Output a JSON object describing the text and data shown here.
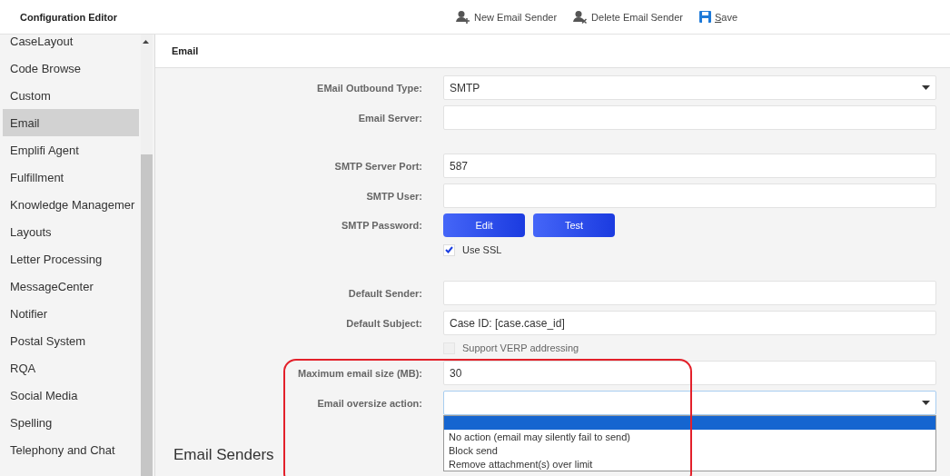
{
  "window": {
    "title": "Configuration Editor"
  },
  "toolbar": [
    {
      "kind": "add-person",
      "label": "New Email Sender"
    },
    {
      "kind": "remove-person",
      "label": "Delete Email Sender"
    },
    {
      "kind": "save",
      "label": "Save"
    }
  ],
  "sidebar": {
    "items": [
      {
        "label": "CaseLayout",
        "selected": false
      },
      {
        "label": "Code Browse",
        "selected": false
      },
      {
        "label": "Custom",
        "selected": false
      },
      {
        "label": "Email",
        "selected": true
      },
      {
        "label": "Emplifi Agent",
        "selected": false
      },
      {
        "label": "Fulfillment",
        "selected": false
      },
      {
        "label": "Knowledge Managemer",
        "selected": false
      },
      {
        "label": "Layouts",
        "selected": false
      },
      {
        "label": "Letter Processing",
        "selected": false
      },
      {
        "label": "MessageCenter",
        "selected": false
      },
      {
        "label": "Notifier",
        "selected": false
      },
      {
        "label": "Postal System",
        "selected": false
      },
      {
        "label": "RQA",
        "selected": false
      },
      {
        "label": "Social Media",
        "selected": false
      },
      {
        "label": "Spelling",
        "selected": false
      },
      {
        "label": "Telephony and Chat",
        "selected": false
      }
    ]
  },
  "panel": {
    "title": "Email",
    "sections": [
      [
        {
          "kind": "select",
          "label": "EMail Outbound Type:",
          "value": "SMTP"
        },
        {
          "kind": "text",
          "label": "Email Server:"
        }
      ],
      [
        {
          "kind": "text",
          "label": "SMTP Server Port:",
          "value": "587"
        },
        {
          "kind": "text",
          "label": "SMTP User:"
        },
        {
          "kind": "buttons",
          "label": "SMTP Password:",
          "buttons": [
            "Edit",
            "Test"
          ]
        },
        {
          "kind": "checkbox",
          "text": "Use SSL",
          "checked": true,
          "disabled": false
        }
      ],
      [
        {
          "kind": "text",
          "label": "Default Sender:"
        },
        {
          "kind": "text",
          "label": "Default Subject:",
          "value": "Case ID: [case.case_id]"
        },
        {
          "kind": "checkbox",
          "text": "Support VERP addressing",
          "checked": false,
          "disabled": true
        },
        {
          "kind": "text",
          "label": "Maximum email size (MB):",
          "value": "30"
        },
        {
          "kind": "select",
          "label": "Email oversize action:",
          "expanded": true,
          "options": [
            {
              "selected": true
            },
            {
              "label": "No action (email may silently fail to send)",
              "selected": false
            },
            {
              "label": "Block send",
              "selected": false
            },
            {
              "label": "Remove attachment(s) over limit",
              "selected": false
            }
          ]
        }
      ]
    ],
    "subheading": "Email Senders"
  }
}
